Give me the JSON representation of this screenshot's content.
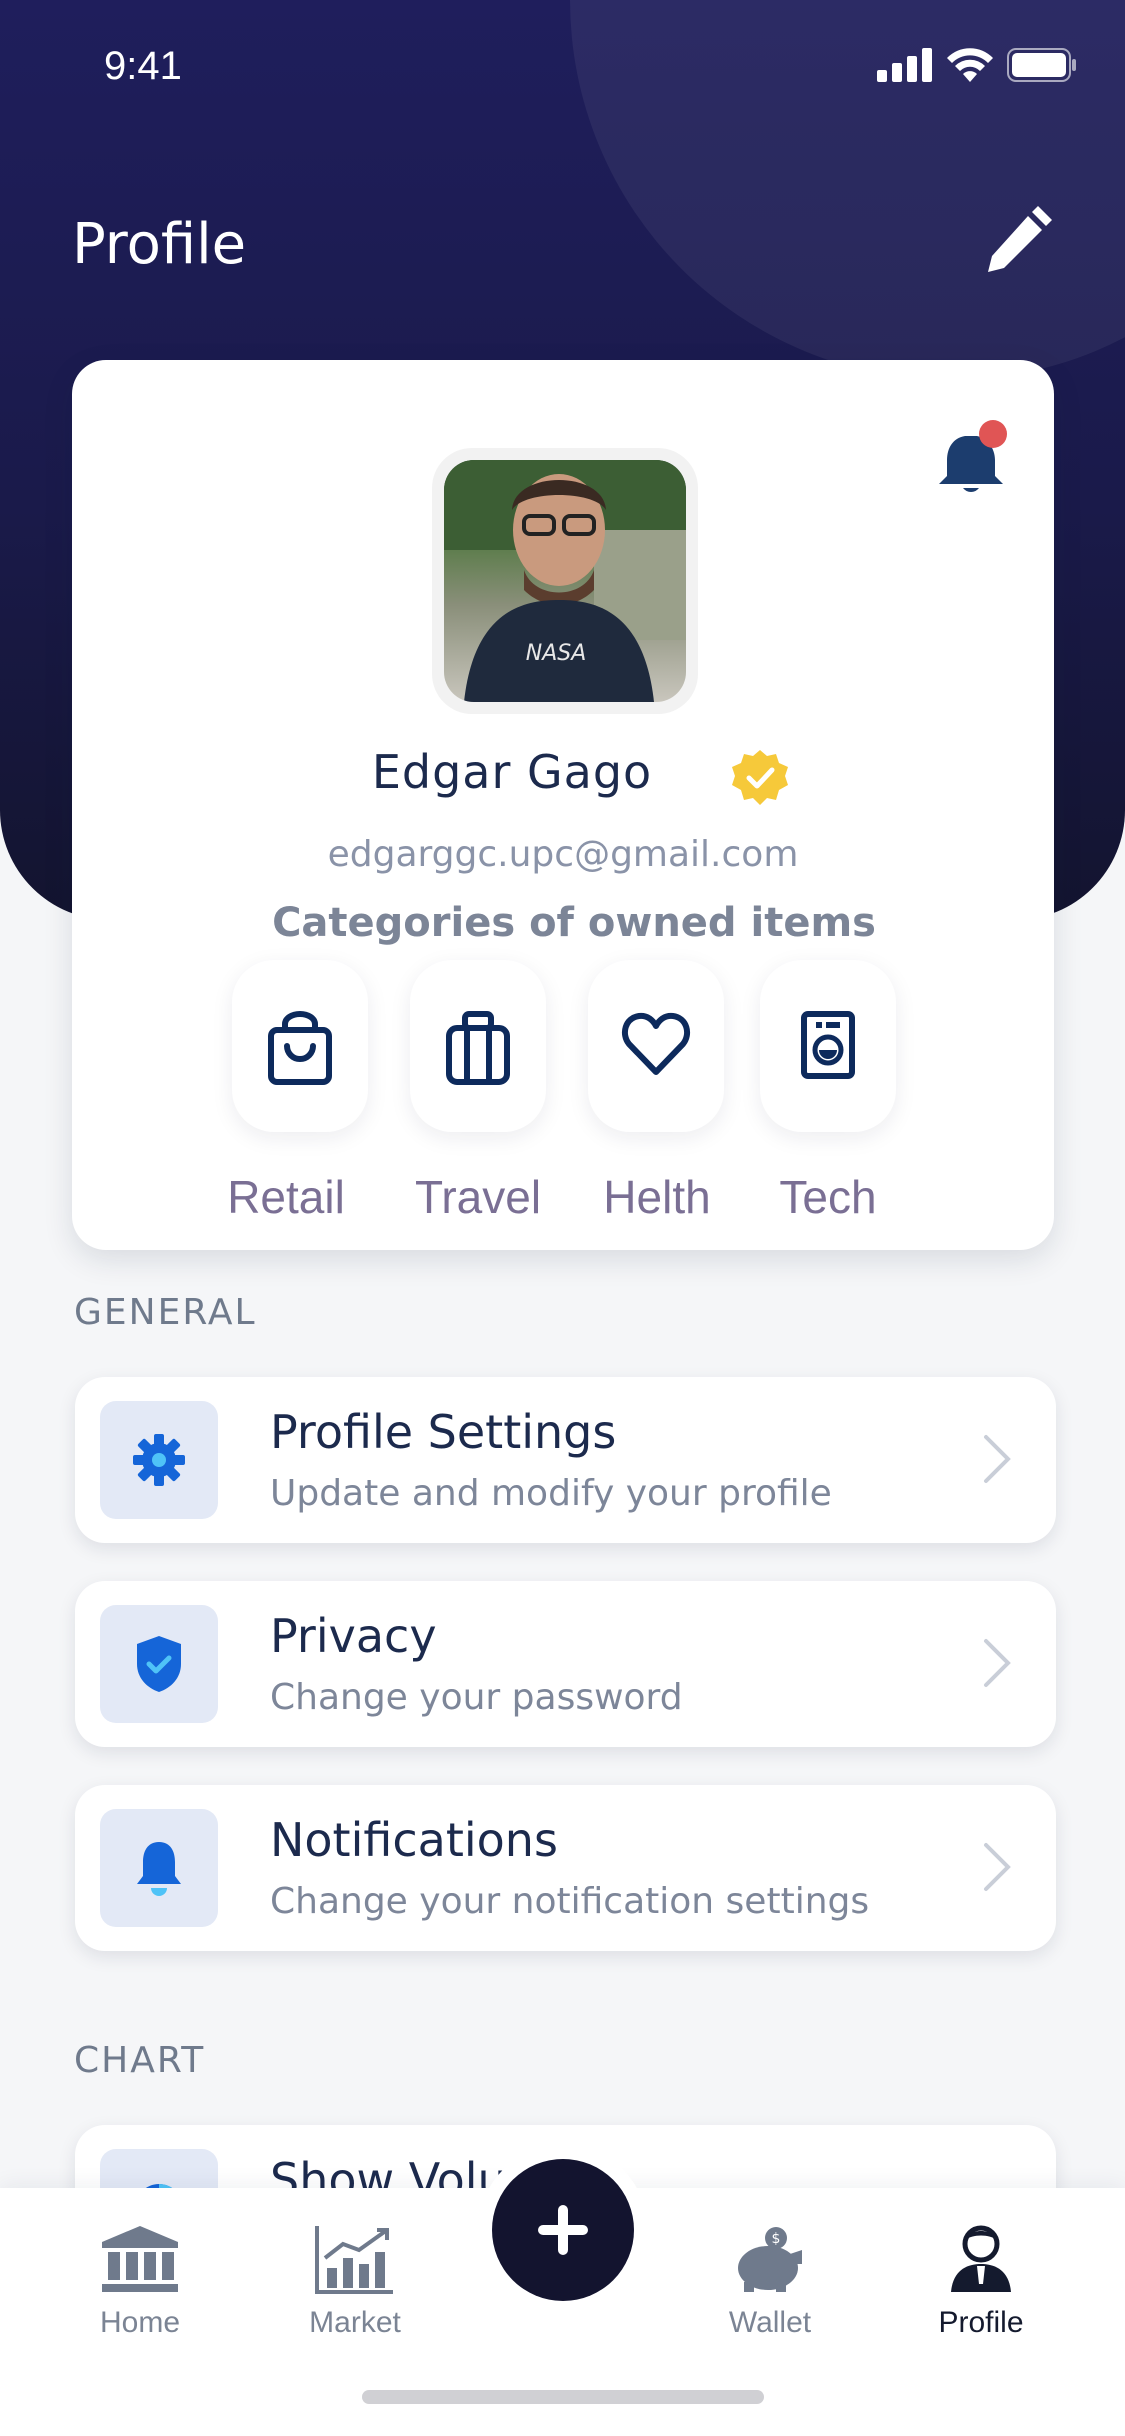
{
  "status_bar": {
    "time": "9:41"
  },
  "header": {
    "title": "Profile"
  },
  "profile": {
    "name": "Edgar Gago",
    "email": "edgarggc.upc@gmail.com",
    "categories_title": "Categories of owned items",
    "categories": [
      {
        "label": "Retail",
        "icon": "shopping-bag-icon"
      },
      {
        "label": "Travel",
        "icon": "suitcase-icon"
      },
      {
        "label": "Helth",
        "icon": "heart-icon"
      },
      {
        "label": "Tech",
        "icon": "washing-machine-icon"
      }
    ]
  },
  "general": {
    "label": "GENERAL",
    "items": [
      {
        "title": "Profile Settings",
        "subtitle": "Update and modify your profile",
        "icon": "gear-icon"
      },
      {
        "title": "Privacy",
        "subtitle": "Change your password",
        "icon": "shield-check-icon"
      },
      {
        "title": "Notifications",
        "subtitle": "Change your notification settings",
        "icon": "bell-icon"
      }
    ]
  },
  "chart": {
    "label": "CHART",
    "items": [
      {
        "title": "Show Volu",
        "icon": "pie-chart-icon"
      }
    ]
  },
  "nav": {
    "items": [
      {
        "label": "Home",
        "icon": "bank-icon"
      },
      {
        "label": "Market",
        "icon": "bar-chart-icon"
      },
      {
        "label": "Wallet",
        "icon": "piggy-bank-icon"
      },
      {
        "label": "Profile",
        "icon": "user-icon"
      }
    ],
    "active": "Profile"
  },
  "colors": {
    "header_dark": "#1f1e5c",
    "accent_blue": "#1565d8",
    "icon_navy": "#0d2a5c",
    "verified_gold": "#f6c93a",
    "notification_red": "#e05555"
  }
}
